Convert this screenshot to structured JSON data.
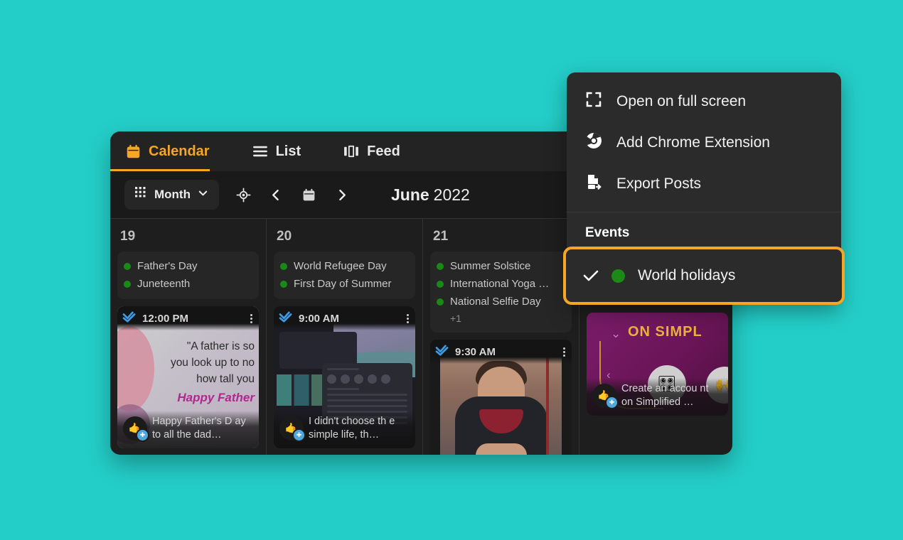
{
  "theme": {
    "background": "#24CEC8",
    "panel_bg": "#1E1E1E",
    "accent": "#F5A623",
    "menu_bg": "#2B2B2B",
    "holiday_dot": "#1A8A16",
    "check_blue": "#3B9CE8"
  },
  "tabs": [
    {
      "label": "Calendar",
      "icon": "calendar-icon",
      "active": true
    },
    {
      "label": "List",
      "icon": "list-icon",
      "active": false
    },
    {
      "label": "Feed",
      "icon": "feed-icon",
      "active": false
    }
  ],
  "toolbar": {
    "view_label": "Month",
    "view_icon": "grid-icon",
    "chevron_icon": "chevron-down-icon",
    "today_icon": "target-icon",
    "prev_icon": "chevron-left-icon",
    "calendar_icon": "calendar-picker-icon",
    "next_icon": "chevron-right-icon",
    "month": "June",
    "year": "2022"
  },
  "days": [
    {
      "number": "19",
      "holidays": [
        "Father's Day",
        "Juneteenth"
      ],
      "more": "",
      "post": {
        "time": "12:00 PM",
        "status_icon": "double-check-icon",
        "menu_icon": "kebab-menu-icon",
        "caption": "Happy Father's D ay to all the dad…",
        "network_icon": "twitter-icon",
        "art": "quote",
        "quote_lines": [
          "\"A father is so",
          "you look up to no",
          "how tall you"
        ],
        "quote_highlight": "Happy Father"
      }
    },
    {
      "number": "20",
      "holidays": [
        "World Refugee Day",
        "First Day of Summer"
      ],
      "more": "",
      "post": {
        "time": "9:00 AM",
        "status_icon": "double-check-icon",
        "menu_icon": "kebab-menu-icon",
        "caption": "I didn't choose th e simple life, th…",
        "network_icon": "twitter-icon",
        "art": "screenshot"
      }
    },
    {
      "number": "21",
      "holidays": [
        "Summer Solstice",
        "International Yoga …",
        "National Selfie Day"
      ],
      "more": "+1",
      "post": {
        "time": "9:30 AM",
        "status_icon": "double-check-icon",
        "menu_icon": "kebab-menu-icon",
        "caption": "",
        "network_icon": "twitter-icon",
        "art": "video"
      }
    },
    {
      "number": "",
      "holidays": [],
      "more": "",
      "post": {
        "time": "",
        "status_icon": "",
        "menu_icon": "",
        "caption": "Create an accou nt on Simplified …",
        "network_icon": "twitter-icon",
        "art": "promo",
        "promo_title": "ON SIMPL"
      }
    }
  ],
  "menu": {
    "items": [
      {
        "label": "Open on full screen",
        "icon": "fullscreen-icon"
      },
      {
        "label": "Add Chrome Extension",
        "icon": "chrome-icon"
      },
      {
        "label": "Export Posts",
        "icon": "export-icon"
      }
    ],
    "section_title": "Events",
    "events": [
      {
        "label": "World holidays",
        "checked": true,
        "color": "#1B8A16",
        "check_icon": "check-icon"
      }
    ]
  }
}
